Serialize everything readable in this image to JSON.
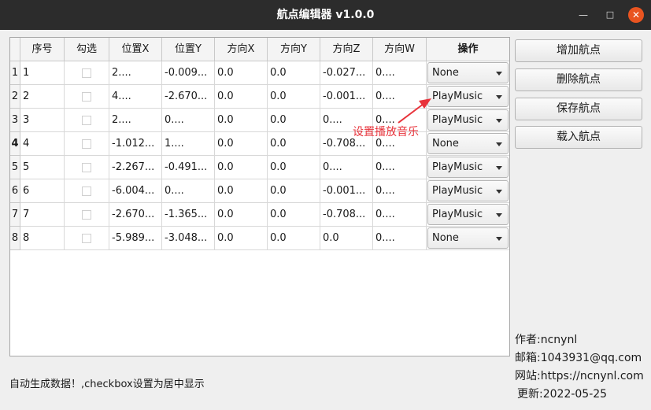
{
  "window": {
    "title": "航点编辑器 v1.0.0",
    "min_symbol": "—",
    "max_symbol": "□",
    "close_symbol": "✕"
  },
  "table": {
    "headers": [
      "序号",
      "勾选",
      "位置X",
      "位置Y",
      "方向X",
      "方向Y",
      "方向Z",
      "方向W",
      "操作"
    ],
    "rows": [
      {
        "row_header": "1",
        "seq": "1",
        "checked": false,
        "px": "2....",
        "py": "-0.009...",
        "ox": "0.0",
        "oy": "0.0",
        "oz": "-0.027...",
        "ow": "0....",
        "action": "None"
      },
      {
        "row_header": "2",
        "seq": "2",
        "checked": false,
        "px": "4....",
        "py": "-2.670...",
        "ox": "0.0",
        "oy": "0.0",
        "oz": "-0.001...",
        "ow": "0....",
        "action": "PlayMusic"
      },
      {
        "row_header": "3",
        "seq": "3",
        "checked": false,
        "px": "2....",
        "py": "0....",
        "ox": "0.0",
        "oy": "0.0",
        "oz": "0....",
        "ow": "0....",
        "action": "PlayMusic"
      },
      {
        "row_header": "4",
        "seq": "4",
        "checked": false,
        "px": "-1.012...",
        "py": "1....",
        "ox": "0.0",
        "oy": "0.0",
        "oz": "-0.708...",
        "ow": "0....",
        "action": "None"
      },
      {
        "row_header": "5",
        "seq": "5",
        "checked": false,
        "px": "-2.267...",
        "py": "-0.491...",
        "ox": "0.0",
        "oy": "0.0",
        "oz": "0....",
        "ow": "0....",
        "action": "PlayMusic"
      },
      {
        "row_header": "6",
        "seq": "6",
        "checked": false,
        "px": "-6.004...",
        "py": "0....",
        "ox": "0.0",
        "oy": "0.0",
        "oz": "-0.001...",
        "ow": "0....",
        "action": "PlayMusic"
      },
      {
        "row_header": "7",
        "seq": "7",
        "checked": false,
        "px": "-2.670...",
        "py": "-1.365...",
        "ox": "0.0",
        "oy": "0.0",
        "oz": "-0.708...",
        "ow": "0....",
        "action": "PlayMusic"
      },
      {
        "row_header": "8",
        "seq": "8",
        "checked": false,
        "px": "-5.989...",
        "py": "-3.048...",
        "ox": "0.0",
        "oy": "0.0",
        "oz": "0.0",
        "ow": "0....",
        "action": "None"
      }
    ]
  },
  "buttons": {
    "add": "增加航点",
    "delete": "删除航点",
    "save": "保存航点",
    "load": "载入航点"
  },
  "annotation": "设置播放音乐",
  "annotation_color": "#e8333b",
  "info": {
    "author": "作者:ncnynl",
    "email": "邮箱:1043931@qq.com",
    "site": "网站:https://ncnynl.com",
    "updated": "更新:2022-05-25"
  },
  "footer": "自动生成数据！,checkbox设置为居中显示",
  "colors": {
    "titlebar": "#2c2c2c",
    "close_button": "#e95420"
  }
}
